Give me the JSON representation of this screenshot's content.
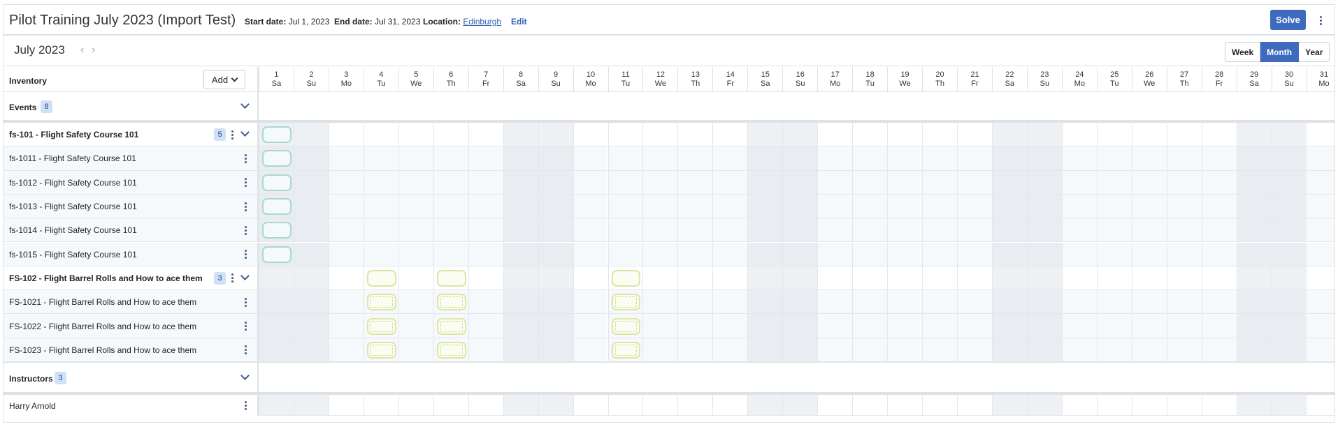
{
  "header": {
    "title": "Pilot Training July 2023 (Import Test)",
    "start_label": "Start date:",
    "start_value": "Jul 1, 2023",
    "end_label": "End date:",
    "end_value": "Jul 31, 2023",
    "location_label": "Location:",
    "location_value": "Edinburgh",
    "edit_label": "Edit",
    "solve_label": "Solve"
  },
  "toolbar": {
    "month_title": "July 2023",
    "prev_icon": "chevron-left-icon",
    "next_icon": "chevron-right-icon",
    "views": [
      "Week",
      "Month",
      "Year"
    ],
    "active_view": "Month"
  },
  "inventory": {
    "label": "Inventory",
    "add_label": "Add"
  },
  "days": [
    {
      "n": "1",
      "d": "Sa"
    },
    {
      "n": "2",
      "d": "Su"
    },
    {
      "n": "3",
      "d": "Mo"
    },
    {
      "n": "4",
      "d": "Tu"
    },
    {
      "n": "5",
      "d": "We"
    },
    {
      "n": "6",
      "d": "Th"
    },
    {
      "n": "7",
      "d": "Fr"
    },
    {
      "n": "8",
      "d": "Sa"
    },
    {
      "n": "9",
      "d": "Su"
    },
    {
      "n": "10",
      "d": "Mo"
    },
    {
      "n": "11",
      "d": "Tu"
    },
    {
      "n": "12",
      "d": "We"
    },
    {
      "n": "13",
      "d": "Th"
    },
    {
      "n": "14",
      "d": "Fr"
    },
    {
      "n": "15",
      "d": "Sa"
    },
    {
      "n": "16",
      "d": "Su"
    },
    {
      "n": "17",
      "d": "Mo"
    },
    {
      "n": "18",
      "d": "Tu"
    },
    {
      "n": "19",
      "d": "We"
    },
    {
      "n": "20",
      "d": "Th"
    },
    {
      "n": "21",
      "d": "Fr"
    },
    {
      "n": "22",
      "d": "Sa"
    },
    {
      "n": "23",
      "d": "Su"
    },
    {
      "n": "24",
      "d": "Mo"
    },
    {
      "n": "25",
      "d": "Tu"
    },
    {
      "n": "26",
      "d": "We"
    },
    {
      "n": "27",
      "d": "Th"
    },
    {
      "n": "28",
      "d": "Fr"
    },
    {
      "n": "29",
      "d": "Sa"
    },
    {
      "n": "30",
      "d": "Su"
    },
    {
      "n": "31",
      "d": "Mo"
    }
  ],
  "sections": {
    "events": {
      "label": "Events",
      "count": "8"
    },
    "instructors": {
      "label": "Instructors",
      "count": "3"
    }
  },
  "rows": [
    {
      "label": "fs-101 - Flight Safety Course 101",
      "group": true,
      "count": "5",
      "color": "teal",
      "event_days": [
        1
      ]
    },
    {
      "label": "fs-1011 - Flight Safety Course 101",
      "group": false,
      "color": "teal",
      "event_days": [
        1
      ]
    },
    {
      "label": "fs-1012 - Flight Safety Course 101",
      "group": false,
      "color": "teal",
      "event_days": [
        1
      ]
    },
    {
      "label": "fs-1013 - Flight Safety Course 101",
      "group": false,
      "color": "teal",
      "event_days": [
        1
      ]
    },
    {
      "label": "fs-1014 - Flight Safety Course 101",
      "group": false,
      "color": "teal",
      "event_days": [
        1
      ]
    },
    {
      "label": "fs-1015 - Flight Safety Course 101",
      "group": false,
      "color": "teal",
      "event_days": [
        1
      ]
    },
    {
      "label": "FS-102 - Flight Barrel Rolls and How to ace them",
      "group": true,
      "count": "3",
      "color": "yellow",
      "event_days": [
        4,
        6,
        11
      ]
    },
    {
      "label": "FS-1021 - Flight Barrel Rolls and How to ace them",
      "group": false,
      "color": "yellow",
      "event_days": [
        4,
        6,
        11
      ]
    },
    {
      "label": "FS-1022 - Flight Barrel Rolls and How to ace them",
      "group": false,
      "color": "yellow",
      "event_days": [
        4,
        6,
        11
      ]
    },
    {
      "label": "FS-1023 - Flight Barrel Rolls and How to ace them",
      "group": false,
      "color": "yellow",
      "event_days": [
        4,
        6,
        11
      ]
    }
  ],
  "instructor_rows": [
    {
      "label": "Harry Arnold"
    }
  ],
  "colors": {
    "accent": "#3e6bbf",
    "badge_bg": "#cfe0f7",
    "teal_event": "#a8d8d0",
    "yellow_event": "#dde5a4"
  }
}
